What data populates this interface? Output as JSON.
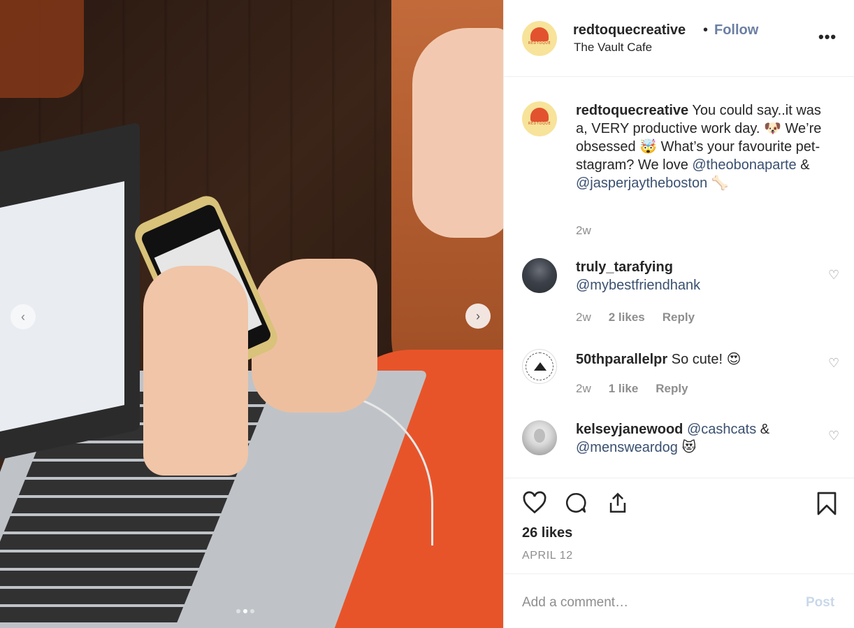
{
  "post": {
    "username": "redtoquecreative",
    "follow_label": "Follow",
    "separator": "•",
    "location": "The Vault Cafe",
    "more_label": "•••",
    "logo_text": "REDTOQUE",
    "caption": {
      "username": "redtoquecreative",
      "text_1": " You could say..it was a, VERY productive work day. 🐶 We’re obsessed 🤯  What’s your favourite pet-stagram? We love ",
      "mention_1": "@theobonaparte",
      "text_2": " & ",
      "mention_2": "@jasperjaytheboston",
      "text_3": " 🦴",
      "age": "2w"
    },
    "comments": [
      {
        "username": "truly_tarafying",
        "text": "",
        "mention": "@mybestfriendhank",
        "age": "2w",
        "likes": "2 likes",
        "reply": "Reply"
      },
      {
        "username": "50thparallelpr",
        "text": " So cute! 😍",
        "mention": "",
        "age": "2w",
        "likes": "1 like",
        "reply": "Reply"
      },
      {
        "username": "kelseyjanewood",
        "text": " ",
        "mention": "@cashcats",
        "text_2": " & ",
        "mention_2": "@mensweardog",
        "text_3": " 😻"
      }
    ],
    "likes_count": "26 likes",
    "date": "APRIL 12",
    "add_comment_placeholder": "Add a comment…",
    "post_label": "Post"
  },
  "carousel": {
    "prev": "‹",
    "next": "›",
    "dots": 3,
    "active_dot": 2
  },
  "colors": {
    "follow": "#6b7fa3",
    "mention": "#3a5070",
    "muted": "#8e8e8e",
    "post_disabled": "#c9d8ea"
  }
}
